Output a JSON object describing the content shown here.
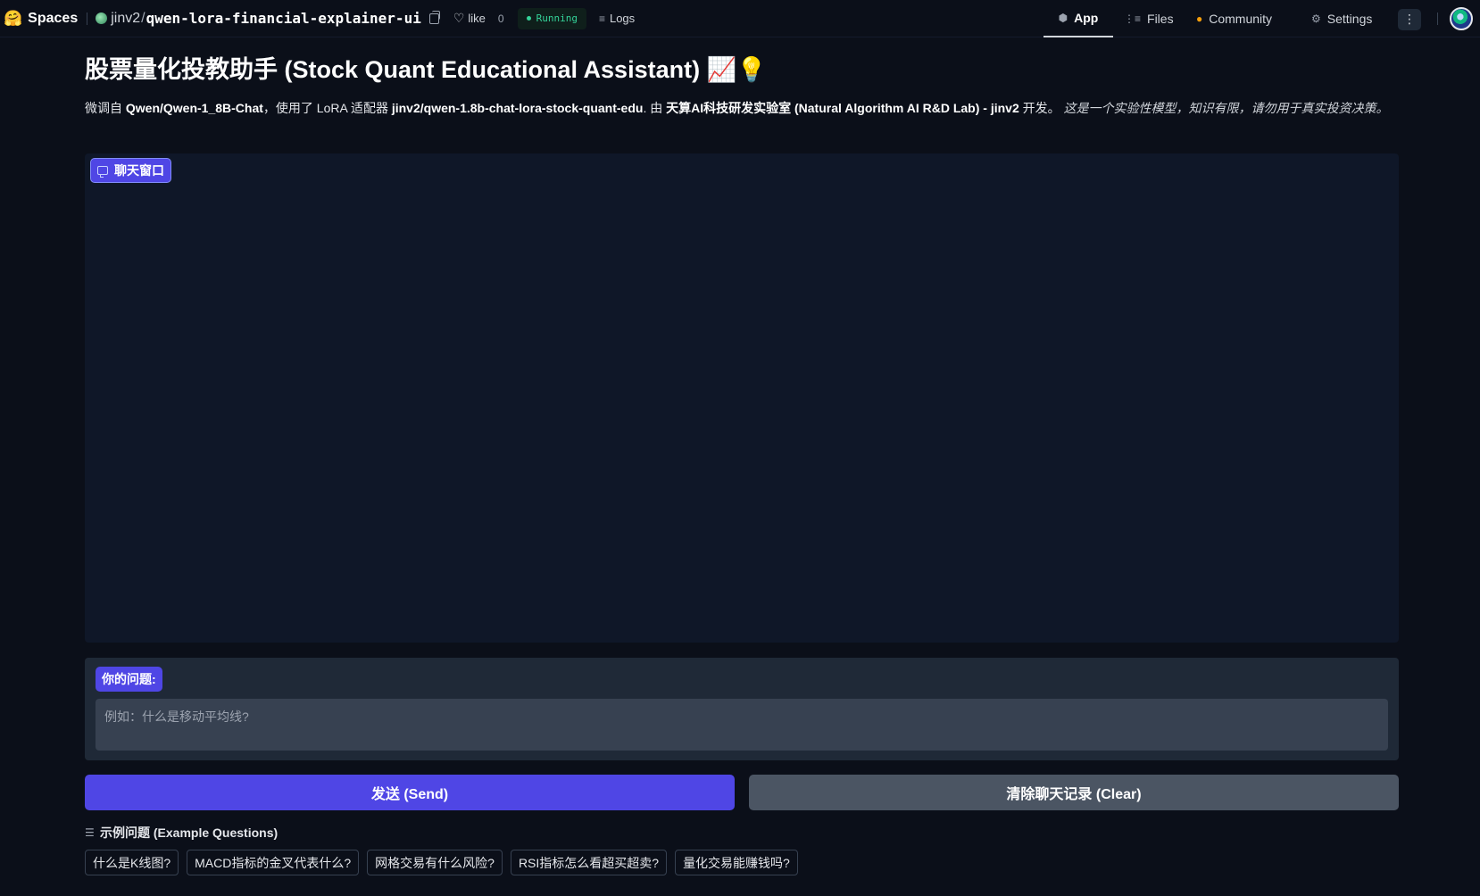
{
  "topbar": {
    "brand": "Spaces",
    "brand_icon": "hugging-face-logo",
    "repo_owner": "jinv2",
    "repo_name": "qwen-lora-financial-explainer-ui",
    "like_label": "like",
    "like_count": "0",
    "status": "Running",
    "logs_label": "Logs",
    "nav": {
      "app": "App",
      "files": "Files",
      "community": "Community",
      "settings": "Settings"
    }
  },
  "main": {
    "title": "股票量化投教助手 (Stock Quant Educational Assistant) 📈💡",
    "description": {
      "p1": "微调自 ",
      "model": "Qwen/Qwen-1_8B-Chat",
      "p2": "，使用了 LoRA 适配器 ",
      "adapter": "jinv2/qwen-1.8b-chat-lora-stock-quant-edu",
      "p3": ". 由 ",
      "org": "天算AI科技研发实验室 (Natural Algorithm AI R&D Lab) - jinv2",
      "p4": " 开发。 ",
      "disclaimer": "这是一个实验性模型，知识有限，请勿用于真实投资决策。"
    },
    "chat_label": "聊天窗口",
    "input_label": "你的问题:",
    "input_placeholder": "例如：什么是移动平均线?",
    "input_value": "",
    "send_button": "发送 (Send)",
    "clear_button": "清除聊天记录 (Clear)",
    "examples_title": "示例问题 (Example Questions)",
    "examples": [
      "什么是K线图?",
      "MACD指标的金叉代表什么?",
      "网格交易有什么风险?",
      "RSI指标怎么看超买超卖?",
      "量化交易能赚钱吗?"
    ]
  },
  "colors": {
    "background": "#0b0f19",
    "accent": "#4f46e5",
    "running": "#34d399",
    "secondary_button": "#4b5563"
  }
}
